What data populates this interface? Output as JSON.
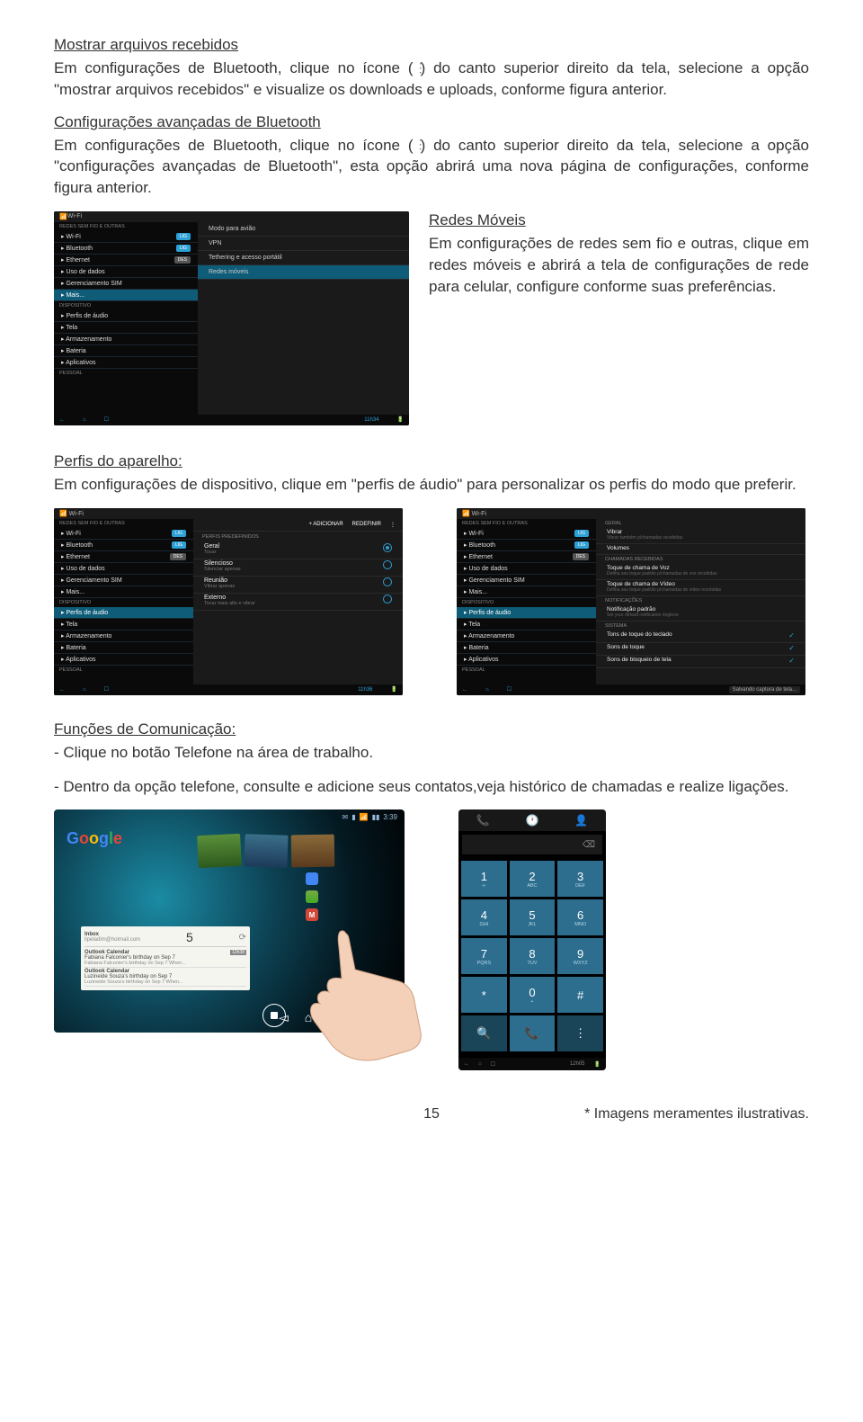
{
  "s1": {
    "title": "Mostrar arquivos recebidos",
    "body_a": "Em configurações de Bluetooth, clique no ícone (",
    "body_b": ") do canto superior direito da tela, selecione a opção \"mostrar arquivos recebidos\" e visualize os downloads e uploads, conforme figura anterior."
  },
  "s2": {
    "title": "Configurações avançadas de Bluetooth",
    "body_a": "Em configurações de Bluetooth, clique no ícone (",
    "body_b": ") do canto superior direito da tela, selecione a opção \"configurações avançadas de Bluetooth\", esta opção abrirá uma nova página de configurações, conforme figura anterior."
  },
  "shot1": {
    "top": "Wi-Fi",
    "grp1": "REDES SEM FIO E OUTRAS",
    "items": [
      {
        "l": "Wi-Fi",
        "p": "LIG",
        "on": true
      },
      {
        "l": "Bluetooth",
        "p": "LIG",
        "on": true
      },
      {
        "l": "Ethernet",
        "p": "DES",
        "on": false
      },
      {
        "l": "Uso de dados"
      },
      {
        "l": "Gerenciamento SIM"
      },
      {
        "l": "Mais...",
        "sel": true
      }
    ],
    "grp2": "DISPOSITIVO",
    "items2": [
      {
        "l": "Perfis de áudio"
      },
      {
        "l": "Tela"
      },
      {
        "l": "Armazenamento"
      },
      {
        "l": "Bateria"
      },
      {
        "l": "Aplicativos"
      }
    ],
    "grp3": "PESSOAL",
    "main": [
      "Modo para avião",
      "VPN",
      "Tethering e acesso portátil",
      "Redes móveis"
    ],
    "mainsel": 3,
    "time": "11h34"
  },
  "redes": {
    "title": "Redes Móveis",
    "body": "Em configurações de redes sem fio e outras, clique em redes móveis e abrirá a tela de configurações de rede para celular, configure conforme suas preferências."
  },
  "perfis": {
    "title": "Perfis do aparelho:",
    "body": "Em configurações de dispositivo, clique em \"perfis de áudio\" para personalizar os perfis do modo que preferir."
  },
  "shot2": {
    "hdr": [
      "+ ADICIONAR",
      "REDEFINIR"
    ],
    "cat": "PERFIS PREDEFINIDOS",
    "profs": [
      {
        "n": "Geral",
        "s": "Tocar",
        "on": true
      },
      {
        "n": "Silencioso",
        "s": "Silenciar apenas"
      },
      {
        "n": "Reunião",
        "s": "Vibrar apenas"
      },
      {
        "n": "Externo",
        "s": "Tocar mais alto e vibrar"
      }
    ],
    "sel": "Perfis de áudio",
    "time": "11h36"
  },
  "shot3": {
    "cats": [
      {
        "h": "GERAL",
        "it": [
          {
            "n": "Vibrar",
            "s": "Vibrar também p/chamadas recebidas"
          }
        ]
      },
      {
        "h": "",
        "it": [
          {
            "n": "Volumes"
          }
        ]
      },
      {
        "h": "CHAMADAS RECEBIDAS",
        "it": [
          {
            "n": "Toque de chama de Voz",
            "s": "Defina seu toque padrão p/chamadas de voz recebidas"
          },
          {
            "n": "Toque de chama de Vídeo",
            "s": "Defina seu toque padrão p/chamadas de vídeo recebidas"
          }
        ]
      },
      {
        "h": "NOTIFICAÇÕES",
        "it": [
          {
            "n": "Notificação padrão",
            "s": "Set your default notification ringtone"
          }
        ]
      },
      {
        "h": "SISTEMA",
        "it": [
          {
            "n": "Tons de toque do teclado",
            "c": true
          },
          {
            "n": "Sons de toque",
            "c": true
          },
          {
            "n": "Sons de bloqueio de tela",
            "c": true
          }
        ]
      }
    ],
    "toast": "Salvando captura de tela..."
  },
  "comm": {
    "title": "Funções de Comunicação:",
    "l1": "- Clique no botão Telefone na área de trabalho.",
    "l2": "- Dentro da opção telefone, consulte e adicione seus contatos,veja histórico de chamadas e realize ligações."
  },
  "tablet": {
    "time": "3:39",
    "inbox_title": "Inbox",
    "inbox_email": "lipeladim@hotmail.com",
    "inbox_count": "5",
    "cal": [
      {
        "h": "Outlook Calendar",
        "e": "Fabiana Falconier's birthday on Sep 7",
        "d": "Fabiana Falconier's birthday on Sep 7 When...",
        "t": "12h38"
      },
      {
        "h": "Outlook Calendar",
        "e": "Luzineide Souza's birthday on Sep 7",
        "d": "Luzineide Souza's birthday on Sep 7 When...",
        "t": ""
      }
    ]
  },
  "phone": {
    "keys": [
      {
        "n": "1",
        "s": "∞"
      },
      {
        "n": "2",
        "s": "ABC"
      },
      {
        "n": "3",
        "s": "DEF"
      },
      {
        "n": "4",
        "s": "GHI"
      },
      {
        "n": "5",
        "s": "JKL"
      },
      {
        "n": "6",
        "s": "MNO"
      },
      {
        "n": "7",
        "s": "PQRS"
      },
      {
        "n": "8",
        "s": "TUV"
      },
      {
        "n": "9",
        "s": "WXYZ"
      },
      {
        "n": "*",
        "s": ""
      },
      {
        "n": "0",
        "s": "+"
      },
      {
        "n": "#",
        "s": ""
      }
    ],
    "time": "12h05"
  },
  "footer": {
    "page": "15",
    "note": "* Imagens meramentes ilustrativas."
  }
}
